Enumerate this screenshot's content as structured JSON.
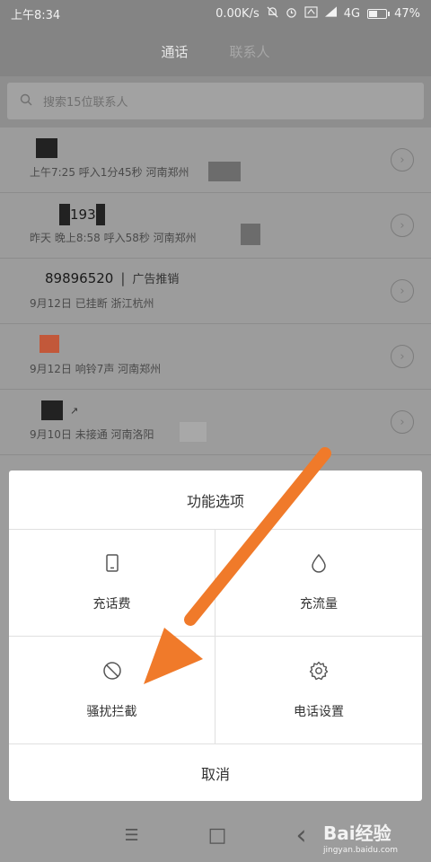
{
  "status_bar": {
    "time": "上午8:34",
    "speed": "0.00K/s",
    "network": "4G",
    "battery": "47%",
    "battery_level": 0.47
  },
  "tabs": [
    {
      "label": "通话",
      "active": true
    },
    {
      "label": "联系人",
      "active": false
    }
  ],
  "search": {
    "placeholder": "搜索15位联系人"
  },
  "calls": [
    {
      "name": "",
      "info": "上午7:25 呼入1分45秒 河南郑州"
    },
    {
      "name": "193",
      "info": "昨天 晚上8:58 呼入58秒 河南郑州"
    },
    {
      "name": "89896520",
      "tag": "广告推销",
      "info": "9月12日 已挂断 浙江杭州"
    },
    {
      "name": "",
      "info": "9月12日 响铃7声 河南郑州"
    },
    {
      "name": "",
      "info": "9月10日 未接通 河南洛阳"
    }
  ],
  "dialog": {
    "title": "功能选项",
    "options": [
      {
        "label": "充话费",
        "icon": "phone-icon"
      },
      {
        "label": "充流量",
        "icon": "drop-icon"
      },
      {
        "label": "骚扰拦截",
        "icon": "block-icon"
      },
      {
        "label": "电话设置",
        "icon": "gear-icon"
      }
    ],
    "cancel": "取消"
  },
  "nav": {
    "menu": "☰",
    "home": "□",
    "back": "‹"
  },
  "watermark": {
    "brand": "Bai经验",
    "url": "jingyan.baidu.com"
  },
  "colors": {
    "arrow": "#f07a2a",
    "dim_overlay": "#9c9c9c"
  }
}
